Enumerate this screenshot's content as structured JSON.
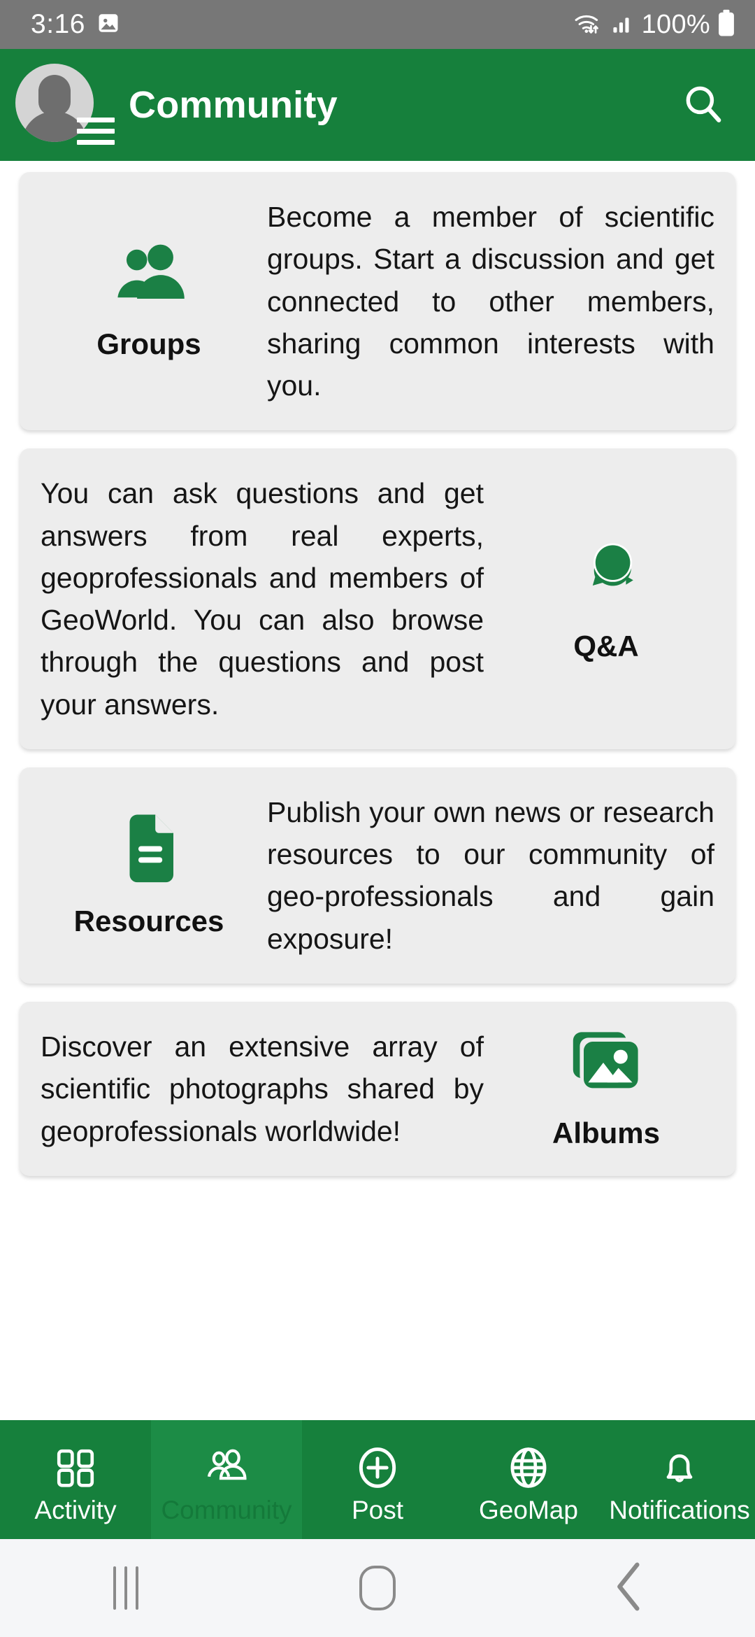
{
  "status_bar": {
    "time": "3:16",
    "battery_percent": "100%",
    "icons": [
      "image-icon",
      "wifi-icon",
      "cellular-signal-icon",
      "battery-icon"
    ]
  },
  "app_bar": {
    "title": "Community",
    "avatar_name": "user-avatar",
    "menu_icon": "hamburger-menu-icon",
    "search_icon": "search-icon"
  },
  "theme": {
    "brand_green": "#16803C",
    "active_tab_green": "#1C8C46",
    "card_background": "#EDEDED",
    "status_bar_gray": "#777777",
    "nav_bar_background": "#F5F6F8"
  },
  "cards": [
    {
      "id": "groups",
      "label": "Groups",
      "icon": "people-group-icon",
      "icon_position": "left",
      "description": "Become a member of scientific groups. Start a discussion and get connected to other members, sharing common interests with you."
    },
    {
      "id": "qa",
      "label": "Q&A",
      "icon": "speech-bubbles-icon",
      "icon_position": "right",
      "description": "You can ask questions and get answers from real experts, geoprofessionals and members of GeoWorld. You can also browse through the questions and post your answers."
    },
    {
      "id": "resources",
      "label": "Resources",
      "icon": "document-icon",
      "icon_position": "left",
      "description": "Publish your own news or research resources to our community of geo-professionals and gain exposure!"
    },
    {
      "id": "albums",
      "label": "Albums",
      "icon": "photo-stack-icon",
      "icon_position": "right",
      "description": "Discover an extensive array of scientific photographs shared by geoprofessionals worldwide!"
    }
  ],
  "bottom_tabs": [
    {
      "label": "Activity",
      "icon": "grid-icon",
      "active": false
    },
    {
      "label": "Community",
      "icon": "people-icon",
      "active": true
    },
    {
      "label": "Post",
      "icon": "plus-circle-icon",
      "active": false
    },
    {
      "label": "GeoMap",
      "icon": "globe-icon",
      "active": false
    },
    {
      "label": "Notifications",
      "icon": "bell-icon",
      "active": false
    }
  ],
  "android_nav": {
    "recents": "recents-icon",
    "home": "home-icon",
    "back": "back-icon"
  }
}
